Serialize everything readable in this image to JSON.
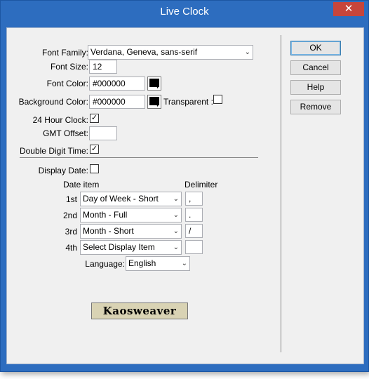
{
  "window": {
    "title": "Live Clock",
    "close_glyph": "✕"
  },
  "form": {
    "font_family": {
      "label": "Font Family:",
      "value": "Verdana, Geneva, sans-serif"
    },
    "font_size": {
      "label": "Font Size:",
      "value": "12"
    },
    "font_color": {
      "label": "Font Color:",
      "value": "#000000",
      "swatch": "#000000"
    },
    "background_color": {
      "label": "Background Color:",
      "value": "#000000",
      "swatch": "#000000"
    },
    "transparent": {
      "label": "Transparent :",
      "checked": false
    },
    "hour24": {
      "label": "24 Hour Clock:",
      "checked": true
    },
    "gmt_offset": {
      "label": "GMT Offset:",
      "value": ""
    },
    "double_digit": {
      "label": "Double Digit Time:",
      "checked": true
    },
    "display_date": {
      "label": "Display Date:",
      "checked": false
    },
    "date_item_header": "Date item",
    "delimiter_header": "Delimiter",
    "date_items": [
      {
        "ordinal": "1st",
        "value": "Day of Week - Short",
        "delimiter": ","
      },
      {
        "ordinal": "2nd",
        "value": "Month - Full",
        "delimiter": "."
      },
      {
        "ordinal": "3rd",
        "value": "Month - Short",
        "delimiter": "/"
      },
      {
        "ordinal": "4th",
        "value": "Select Display Item",
        "delimiter": ""
      }
    ],
    "language": {
      "label": "Language:",
      "value": "English"
    }
  },
  "buttons": {
    "ok": "OK",
    "cancel": "Cancel",
    "help": "Help",
    "remove": "Remove"
  },
  "logo_text": "Kaosweaver",
  "check_glyph": "✓",
  "arrow_glyph": "⌄"
}
